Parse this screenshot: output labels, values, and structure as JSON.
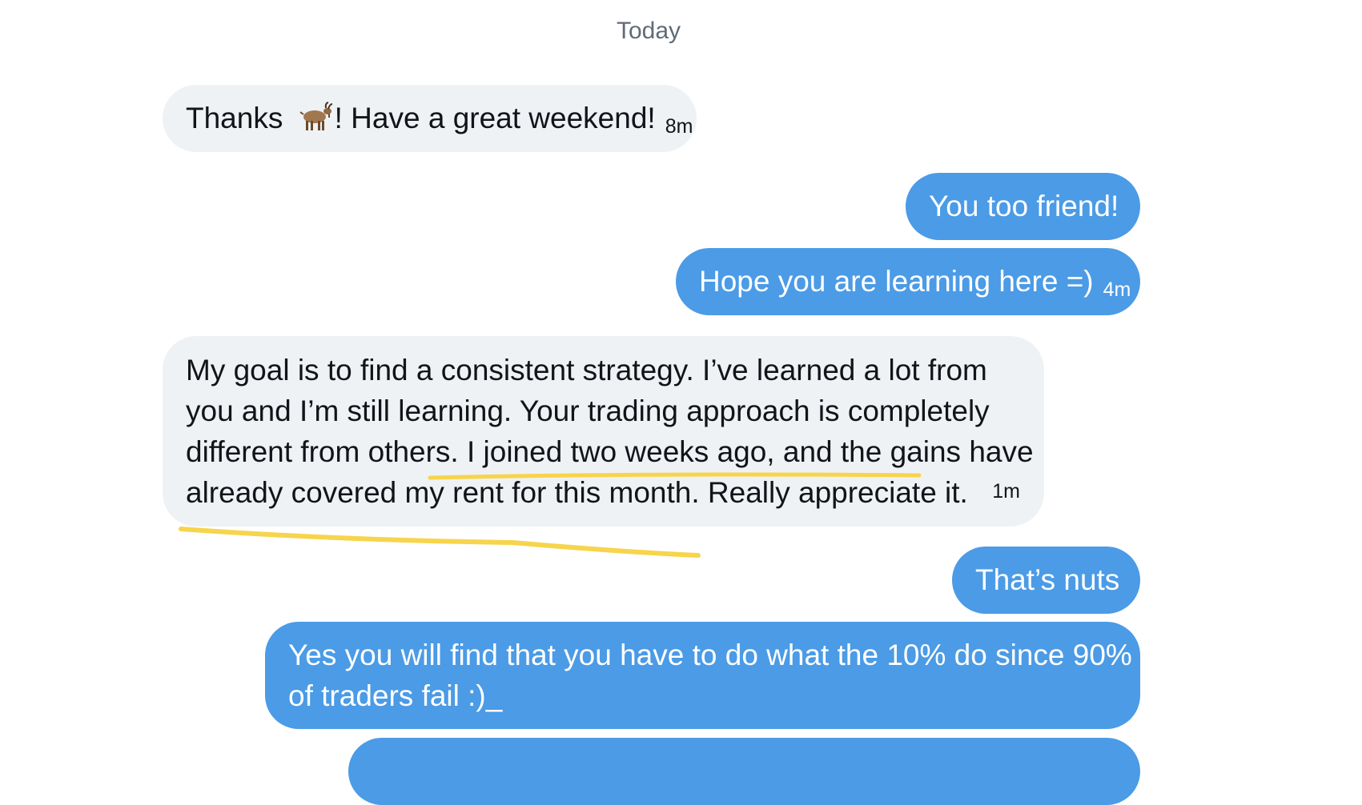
{
  "thread": {
    "date_separator": "Today",
    "messages": [
      {
        "sender": "them",
        "text_before_emoji": "Thanks ",
        "emoji": "goat",
        "text_after_emoji": "! Have a great weekend!",
        "time": "8m"
      },
      {
        "sender": "me",
        "text": "You too friend!"
      },
      {
        "sender": "me",
        "text": "Hope you are learning here =)",
        "time": "4m"
      },
      {
        "sender": "them",
        "lines": [
          "My goal is to find a consistent strategy. I’ve learned a lot from",
          "you and I’m still learning. Your trading approach is completely",
          "different from others. I joined two weeks ago, and the gains have",
          "already covered my rent for this month. Really appreciate it."
        ],
        "time": "1m"
      },
      {
        "sender": "me",
        "text": "That’s nuts"
      },
      {
        "sender": "me",
        "lines": [
          "Yes you will find that you have to do what the 10% do since 90%",
          "of traders fail :)_"
        ]
      }
    ]
  },
  "colors": {
    "incoming_bubble": "#eff2f4",
    "outgoing_bubble": "#4b9be6",
    "highlight_underline": "#f7d44c"
  },
  "icons": {
    "goat_emoji": "goat-emoji-icon"
  }
}
